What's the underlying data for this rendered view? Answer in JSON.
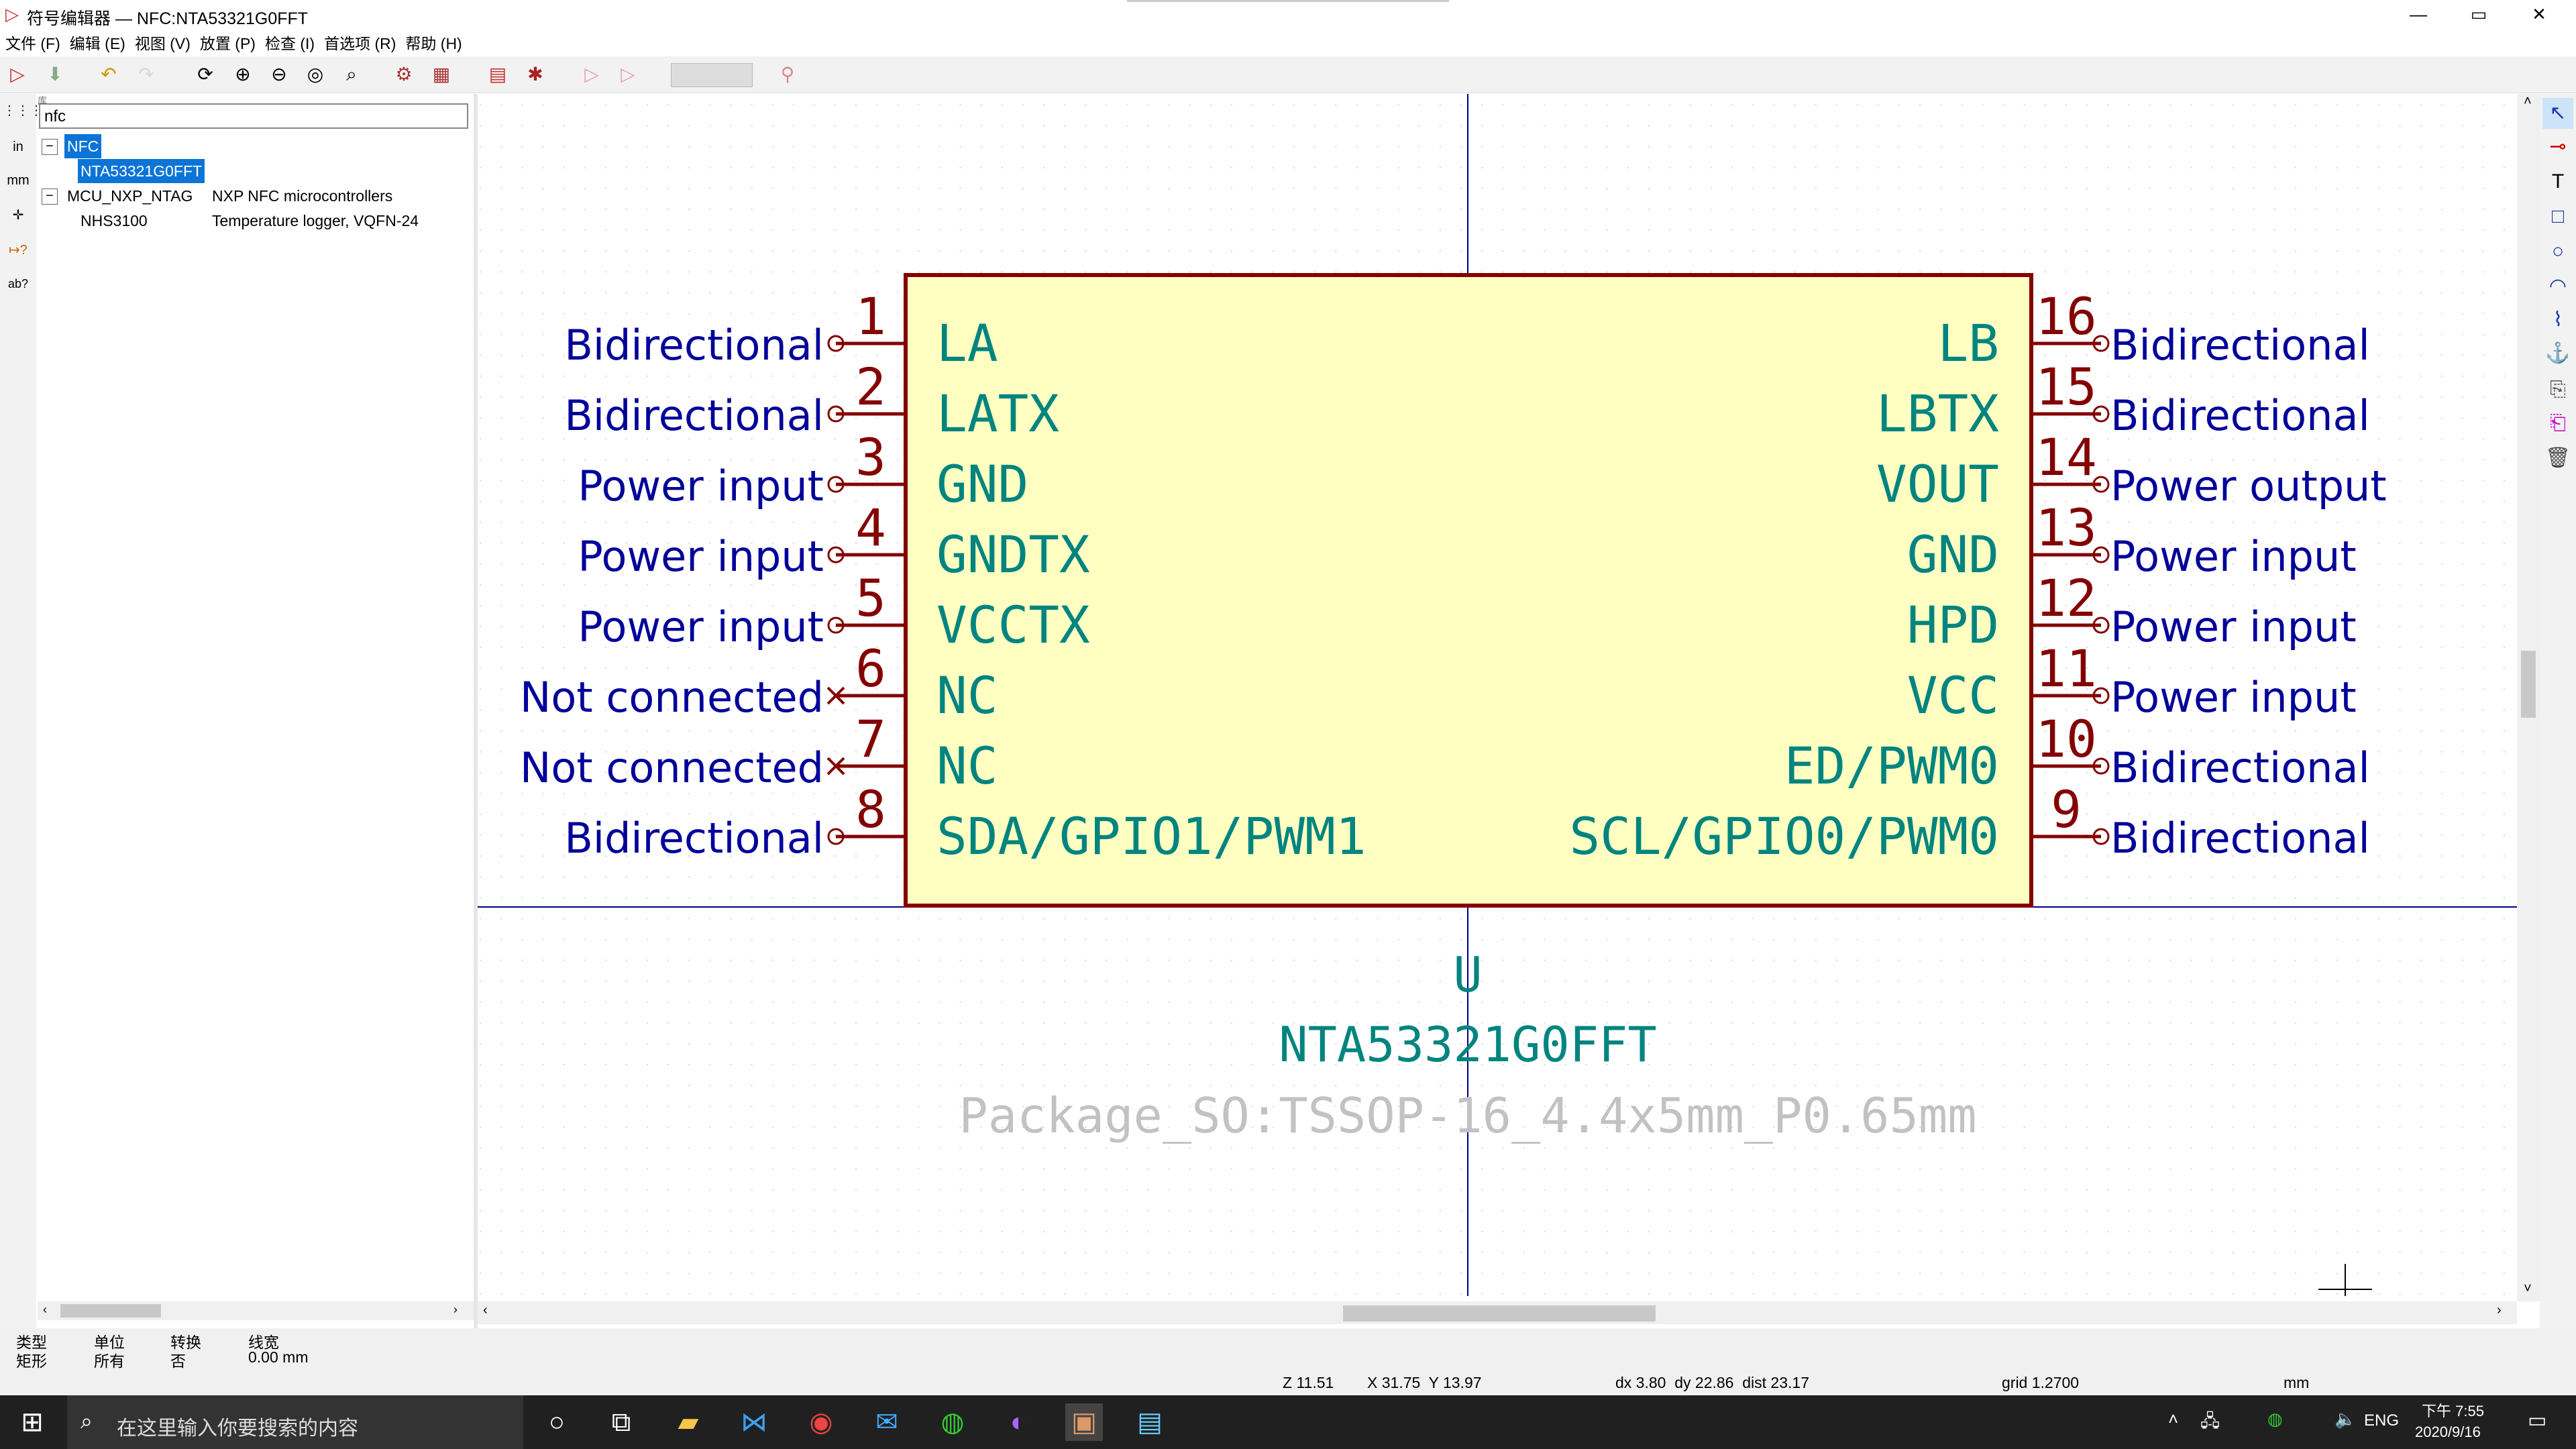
{
  "window": {
    "title": "符号编辑器 — NFC:NTA53321G0FFT",
    "minimize": "—",
    "maximize": "▭",
    "close": "✕"
  },
  "menu": [
    "文件 (F)",
    "编辑 (E)",
    "视图 (V)",
    "放置 (P)",
    "检查 (I)",
    "首选项 (R)",
    "帮助 (H)"
  ],
  "library": {
    "header": "库",
    "search_value": "nfc",
    "rows": [
      {
        "expander": "−",
        "name": "NFC",
        "desc": "",
        "selected": true
      },
      {
        "expander": "",
        "name": "NTA53321G0FFT",
        "desc": "",
        "selected": true
      },
      {
        "expander": "−",
        "name": "MCU_NXP_NTAG",
        "desc": "NXP NFC microcontrollers",
        "selected": false
      },
      {
        "expander": "",
        "name": "NHS3100",
        "desc": "Temperature logger, VQFN-24",
        "selected": false
      }
    ]
  },
  "symbol": {
    "reference": "U",
    "value": "NTA53321G0FFT",
    "footprint": "Package_SO:TSSOP-16_4.4x5mm_P0.65mm",
    "left_pins": [
      {
        "num": "1",
        "name": "LA",
        "type": "Bidirectional",
        "nc": false
      },
      {
        "num": "2",
        "name": "LATX",
        "type": "Bidirectional",
        "nc": false
      },
      {
        "num": "3",
        "name": "GND",
        "type": "Power input",
        "nc": false
      },
      {
        "num": "4",
        "name": "GNDTX",
        "type": "Power input",
        "nc": false
      },
      {
        "num": "5",
        "name": "VCCTX",
        "type": "Power input",
        "nc": false
      },
      {
        "num": "6",
        "name": "NC",
        "type": "Not connected",
        "nc": true
      },
      {
        "num": "7",
        "name": "NC",
        "type": "Not connected",
        "nc": true
      },
      {
        "num": "8",
        "name": "SDA/GPIO1/PWM1",
        "type": "Bidirectional",
        "nc": false
      }
    ],
    "right_pins": [
      {
        "num": "16",
        "name": "LB",
        "type": "Bidirectional",
        "nc": false
      },
      {
        "num": "15",
        "name": "LBTX",
        "type": "Bidirectional",
        "nc": false
      },
      {
        "num": "14",
        "name": "VOUT",
        "type": "Power output",
        "nc": false
      },
      {
        "num": "13",
        "name": "GND",
        "type": "Power input",
        "nc": false
      },
      {
        "num": "12",
        "name": "HPD",
        "type": "Power input",
        "nc": false
      },
      {
        "num": "11",
        "name": "VCC",
        "type": "Power input",
        "nc": false
      },
      {
        "num": "10",
        "name": "ED/PWM0",
        "type": "Bidirectional",
        "nc": false
      },
      {
        "num": "9",
        "name": "SCL/GPIO0/PWM0",
        "type": "Bidirectional",
        "nc": false
      }
    ]
  },
  "colors": {
    "body_fill": "#ffffc2",
    "body_stroke": "#840000",
    "pin_name": "#00847f",
    "pin_type": "#00009a",
    "pin_number": "#840000",
    "footprint": "#c2c2c2",
    "axis": "#000084"
  },
  "properties": {
    "type_label": "类型",
    "type_value": "矩形",
    "unit_label": "单位",
    "unit_value": "所有",
    "convert_label": "转换",
    "convert_value": "否",
    "width_label": "线宽",
    "width_value": "0.00 mm"
  },
  "status": {
    "zoom": "Z 11.51",
    "coords": "X 31.75  Y 13.97",
    "delta": "dx 3.80  dy 22.86  dist 23.17",
    "grid": "grid 1.2700",
    "units": "mm"
  },
  "taskbar": {
    "search_placeholder": "在这里输入你要搜索的内容",
    "lang": "ENG",
    "time": "下午 7:55",
    "date": "2020/9/16"
  }
}
